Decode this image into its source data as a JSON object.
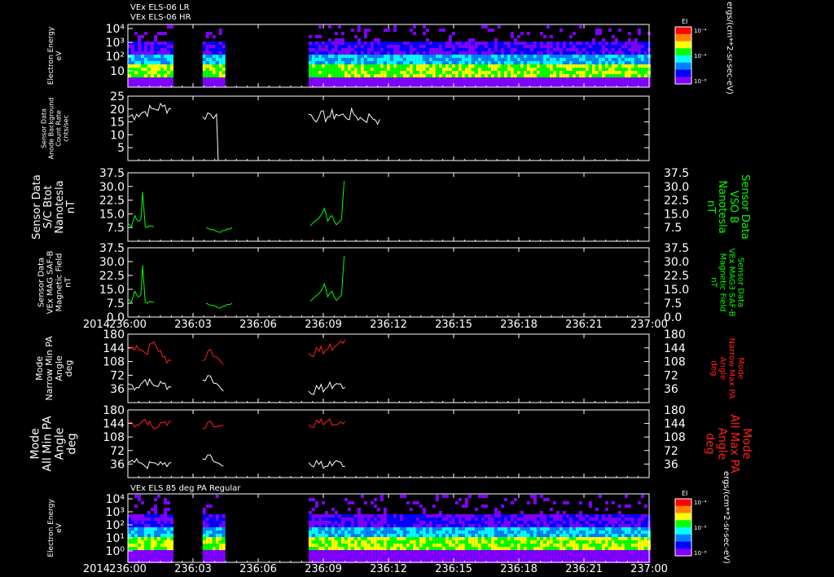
{
  "titles": {
    "top_line1": "VEx ELS-06 LR",
    "top_line2": "VEx ELS-06 HR",
    "bottom": "VEx ELS 85 deg PA Regular"
  },
  "time_axis": {
    "year": "2014",
    "ticks": [
      "236:00",
      "236:03",
      "236:06",
      "236:09",
      "236:12",
      "236:15",
      "236:18",
      "236:21",
      "237:00"
    ]
  },
  "colorbar": {
    "label": "EI",
    "units": "ergs/(cm**2-sr-sec-eV)",
    "ticks": [
      "10⁻⁴",
      "10⁻⁶",
      "10⁻⁸"
    ],
    "colors": [
      "#ff0000",
      "#ff8000",
      "#ffff00",
      "#00ff00",
      "#00ffff",
      "#0080ff",
      "#0000ff",
      "#8000ff"
    ]
  },
  "panels": {
    "spec1": {
      "ylabel": [
        "Electron Energy",
        "eV"
      ],
      "yticks": [
        "10⁴",
        "10³",
        "10²",
        "10"
      ]
    },
    "bg": {
      "ylabel": [
        "Sensor Data",
        "Anode Background",
        "Count Rate",
        "cnts/sec"
      ],
      "yticks": [
        "25",
        "20",
        "15",
        "10",
        "5"
      ]
    },
    "b1": {
      "ylabel": [
        "Sensor Data",
        "S/C Btot",
        "Nanotesla",
        "nT"
      ],
      "ylabel_right": [
        "Sensor Data",
        "VSO B",
        "Nanotesla",
        "nT"
      ],
      "yticks": [
        "37.5",
        "30.0",
        "22.5",
        "15.0",
        "7.5"
      ]
    },
    "b2": {
      "ylabel": [
        "Sensor Data",
        "VEx MAG SAF-B",
        "Magnetic Field",
        "nT"
      ],
      "ylabel_right": [
        "Sensor Data",
        "VEx MAG3 SAF-B",
        "Magnetic Field",
        "nT"
      ],
      "yticks": [
        "37.5",
        "30.0",
        "22.5",
        "15.0",
        "7.5",
        "0.0"
      ]
    },
    "pa1": {
      "ylabel": [
        "Mode",
        "Narrow Min PA",
        "Angle",
        "deg"
      ],
      "ylabel_right": [
        "Mode",
        "Narrow Max PA",
        "Angle",
        "deg"
      ],
      "yticks": [
        "180",
        "144",
        "108",
        "72",
        "36"
      ]
    },
    "pa2": {
      "ylabel": [
        "Mode",
        "All Min PA",
        "Angle",
        "deg"
      ],
      "ylabel_right": [
        "Mode",
        "All Max PA",
        "Angle",
        "deg"
      ],
      "yticks": [
        "180",
        "144",
        "108",
        "72",
        "36"
      ]
    },
    "spec2": {
      "ylabel": [
        "Electron Energy",
        "eV"
      ],
      "yticks": [
        "10⁴",
        "10³",
        "10²",
        "10¹",
        "10⁰"
      ]
    }
  },
  "chart_data": [
    {
      "type": "heatmap",
      "title": "VEx ELS-06 LR / VEx ELS-06 HR",
      "ylabel": "Electron Energy (eV)",
      "xlim": [
        "236:00",
        "237:00"
      ],
      "yscale": "log",
      "data_intervals": [
        [
          "236:00",
          "236:05.2"
        ],
        [
          "236:08.6",
          "236:11.0"
        ],
        [
          "236:20.8",
          "237:00"
        ]
      ]
    },
    {
      "type": "line",
      "ylabel": "Anode Background Count Rate (cnts/sec)",
      "ylim": [
        0,
        25
      ],
      "series": [
        {
          "color": "#ffffff",
          "x": [
            "236:00",
            "236:01",
            "236:02",
            "236:03",
            "236:04",
            "236:05",
            "236:08.6",
            "236:09.5",
            "236:10.2",
            "236:10.4",
            "236:20.8",
            "236:22",
            "236:23",
            "236:24",
            "236:25",
            "236:26",
            "236:27",
            "236:28",
            "236:29",
            "237:00"
          ],
          "values": [
            17,
            18,
            19,
            20,
            21,
            20,
            17,
            18,
            18,
            0,
            18,
            17,
            17,
            18,
            17,
            18,
            16,
            17,
            16,
            18
          ]
        }
      ]
    },
    {
      "type": "line",
      "ylabel": "S/C Btot (nT)",
      "ylim": [
        0,
        37.5
      ],
      "series": [
        {
          "color": "#00ff00",
          "x": [
            "236:00",
            "236:00.4",
            "236:00.8",
            "236:01.2",
            "236:01.5",
            "236:01.7",
            "236:02",
            "236:03",
            "236:06",
            "236:09",
            "236:10.4",
            "236:12",
            "236:15",
            "236:18",
            "236:21",
            "236:22.2",
            "236:22.6",
            "236:23",
            "236:23.5",
            "236:24",
            "236:24.6",
            "236:24.9",
            "237:00"
          ],
          "values": [
            10,
            8,
            14,
            11,
            12,
            27,
            8,
            8,
            7.5,
            7.5,
            5,
            7.5,
            7.5,
            8,
            8.5,
            14,
            18,
            11,
            14,
            9,
            12,
            33,
            23
          ]
        }
      ]
    },
    {
      "type": "line",
      "ylabel": "VEx MAG SAF-B Magnetic Field (nT)",
      "ylim": [
        0,
        37.5
      ],
      "series": [
        {
          "color": "#00ff00",
          "x": [
            "236:00",
            "236:00.4",
            "236:00.8",
            "236:01.2",
            "236:01.5",
            "236:01.7",
            "236:02",
            "236:03",
            "236:06",
            "236:09",
            "236:10.4",
            "236:12",
            "236:15",
            "236:18",
            "236:21",
            "236:22.2",
            "236:22.6",
            "236:23",
            "236:23.5",
            "236:24",
            "236:24.6",
            "236:24.9",
            "237:00"
          ],
          "values": [
            10,
            8,
            14,
            11,
            12,
            28,
            8,
            8,
            7.5,
            7.5,
            5,
            7.5,
            7.5,
            8,
            8.5,
            14,
            18,
            11,
            14,
            9,
            12,
            33,
            23
          ]
        }
      ]
    },
    {
      "type": "line",
      "ylabel": "Narrow Min/Max PA Angle (deg)",
      "ylim": [
        0,
        180
      ],
      "series": [
        {
          "color": "#ff2020",
          "x": [
            "236:00",
            "236:01",
            "236:02",
            "236:03",
            "236:04",
            "236:05",
            "236:08.6",
            "236:09.5",
            "236:10.2",
            "236:11",
            "236:20.8",
            "236:22",
            "236:23",
            "236:24",
            "236:25",
            "237:00"
          ],
          "values": [
            140,
            150,
            130,
            160,
            120,
            110,
            110,
            140,
            120,
            100,
            130,
            135,
            140,
            150,
            165,
            170
          ]
        },
        {
          "color": "#ffffff",
          "x": [
            "236:00",
            "236:01",
            "236:02",
            "236:03",
            "236:04",
            "236:05",
            "236:08.6",
            "236:09.5",
            "236:10.2",
            "236:11",
            "236:20.8",
            "236:22",
            "236:23",
            "236:24",
            "236:25",
            "237:00"
          ],
          "values": [
            50,
            40,
            60,
            45,
            50,
            40,
            60,
            70,
            50,
            30,
            30,
            35,
            40,
            50,
            40,
            60
          ]
        }
      ]
    },
    {
      "type": "line",
      "ylabel": "All Min/Max PA Angle (deg)",
      "ylim": [
        0,
        180
      ],
      "series": [
        {
          "color": "#ff2020",
          "x": [
            "236:00",
            "236:01",
            "236:02",
            "236:03",
            "236:04",
            "236:05",
            "236:08.6",
            "236:09.5",
            "236:10.2",
            "236:11",
            "236:20.8",
            "236:22",
            "236:23",
            "236:24",
            "236:25",
            "237:00"
          ],
          "values": [
            150,
            140,
            155,
            130,
            145,
            150,
            130,
            150,
            135,
            140,
            140,
            145,
            150,
            140,
            150,
            155
          ]
        },
        {
          "color": "#ffffff",
          "x": [
            "236:00",
            "236:01",
            "236:02",
            "236:03",
            "236:04",
            "236:05",
            "236:08.6",
            "236:09.5",
            "236:10.2",
            "236:11",
            "236:20.8",
            "236:22",
            "236:23",
            "236:24",
            "236:25",
            "237:00"
          ],
          "values": [
            40,
            50,
            30,
            40,
            35,
            40,
            50,
            60,
            40,
            30,
            40,
            35,
            30,
            45,
            30,
            40
          ]
        }
      ]
    },
    {
      "type": "heatmap",
      "title": "VEx ELS 85 deg PA Regular",
      "ylabel": "Electron Energy (eV)",
      "xlim": [
        "236:00",
        "237:00"
      ],
      "yscale": "log",
      "data_intervals": [
        [
          "236:00",
          "236:05.2"
        ],
        [
          "236:08.6",
          "236:11.0"
        ],
        [
          "236:20.8",
          "237:00"
        ]
      ]
    }
  ]
}
